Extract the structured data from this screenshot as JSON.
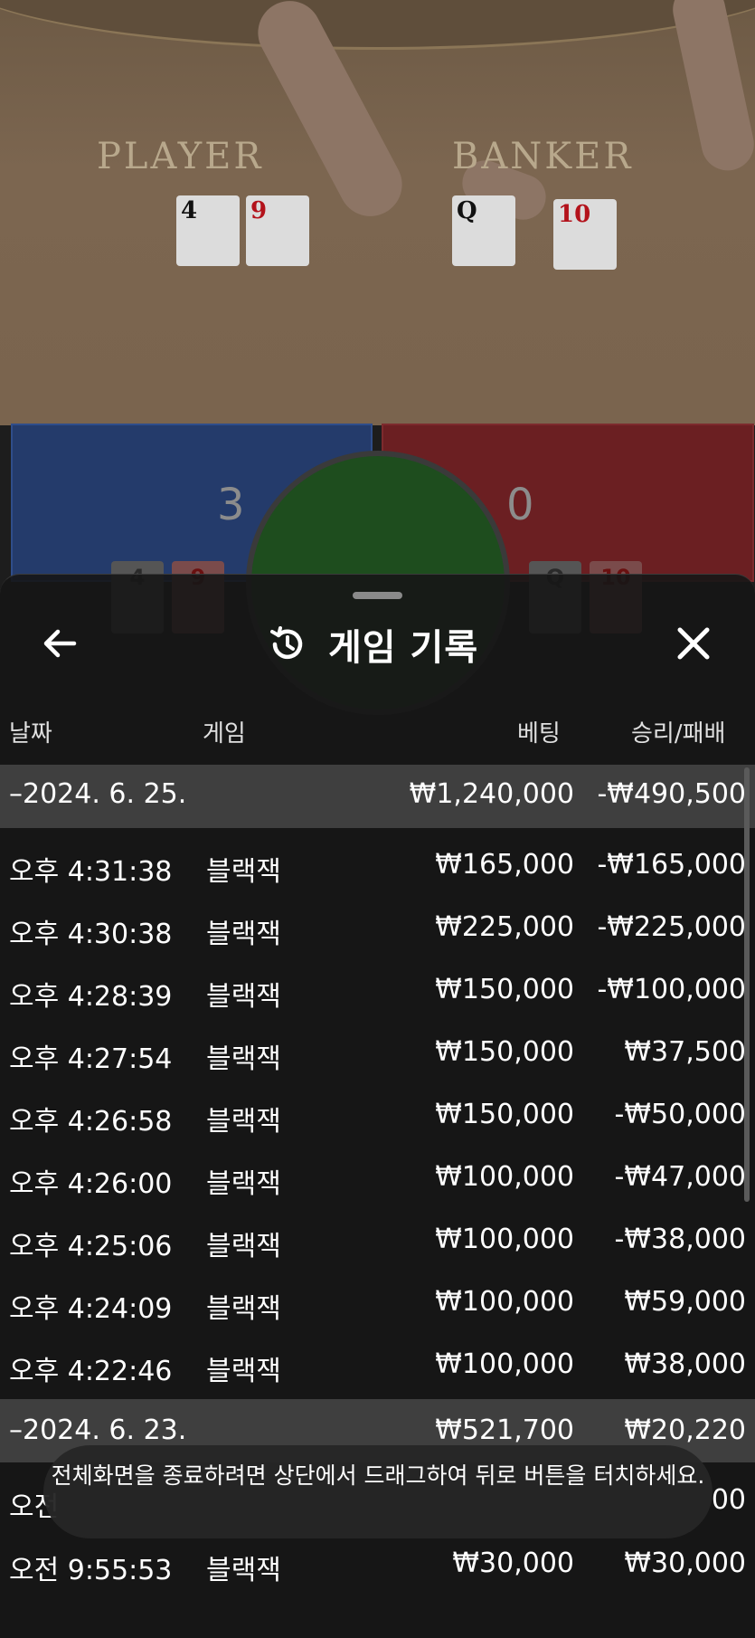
{
  "table": {
    "player_label": "PLAYER",
    "banker_label": "BANKER",
    "player_cards": [
      "4",
      "9"
    ],
    "banker_cards": [
      "Q",
      "10"
    ],
    "player_score": "3",
    "banker_score": "0"
  },
  "sheet": {
    "title": "게임 기록",
    "columns": {
      "date": "날짜",
      "game": "게임",
      "bet": "베팅",
      "result": "승리/패배"
    },
    "groups": [
      {
        "date": "–2024. 6. 25.",
        "bet": "₩1,240,000",
        "result": "-₩490,500"
      },
      {
        "date": "–2024. 6. 23.",
        "bet": "₩521,700",
        "result": "₩20,220"
      }
    ],
    "rows": [
      {
        "time": "오후 4:31:38",
        "game": "블랙잭",
        "bet": "₩165,000",
        "result": "-₩165,000"
      },
      {
        "time": "오후 4:30:38",
        "game": "블랙잭",
        "bet": "₩225,000",
        "result": "-₩225,000"
      },
      {
        "time": "오후 4:28:39",
        "game": "블랙잭",
        "bet": "₩150,000",
        "result": "-₩100,000"
      },
      {
        "time": "오후 4:27:54",
        "game": "블랙잭",
        "bet": "₩150,000",
        "result": "₩37,500"
      },
      {
        "time": "오후 4:26:58",
        "game": "블랙잭",
        "bet": "₩150,000",
        "result": "-₩50,000"
      },
      {
        "time": "오후 4:26:00",
        "game": "블랙잭",
        "bet": "₩100,000",
        "result": "-₩47,000"
      },
      {
        "time": "오후 4:25:06",
        "game": "블랙잭",
        "bet": "₩100,000",
        "result": "-₩38,000"
      },
      {
        "time": "오후 4:24:09",
        "game": "블랙잭",
        "bet": "₩100,000",
        "result": "₩59,000"
      },
      {
        "time": "오후 4:22:46",
        "game": "블랙잭",
        "bet": "₩100,000",
        "result": "₩38,000"
      }
    ],
    "partial_rows": [
      {
        "time": "오전",
        "game": "",
        "bet": "",
        "result": "00"
      },
      {
        "time": "오전 9:55:53",
        "game": "블랙잭",
        "bet": "₩30,000",
        "result": "₩30,000"
      }
    ]
  },
  "toast": {
    "text": "전체화면을 종료하려면 상단에서 드래그하여 뒤로 버튼을 터치하세요."
  },
  "colors": {
    "player": "#243b6b",
    "banker": "#6b1f22",
    "tie": "#1e4d1e",
    "sheet_bg": "#161616"
  }
}
